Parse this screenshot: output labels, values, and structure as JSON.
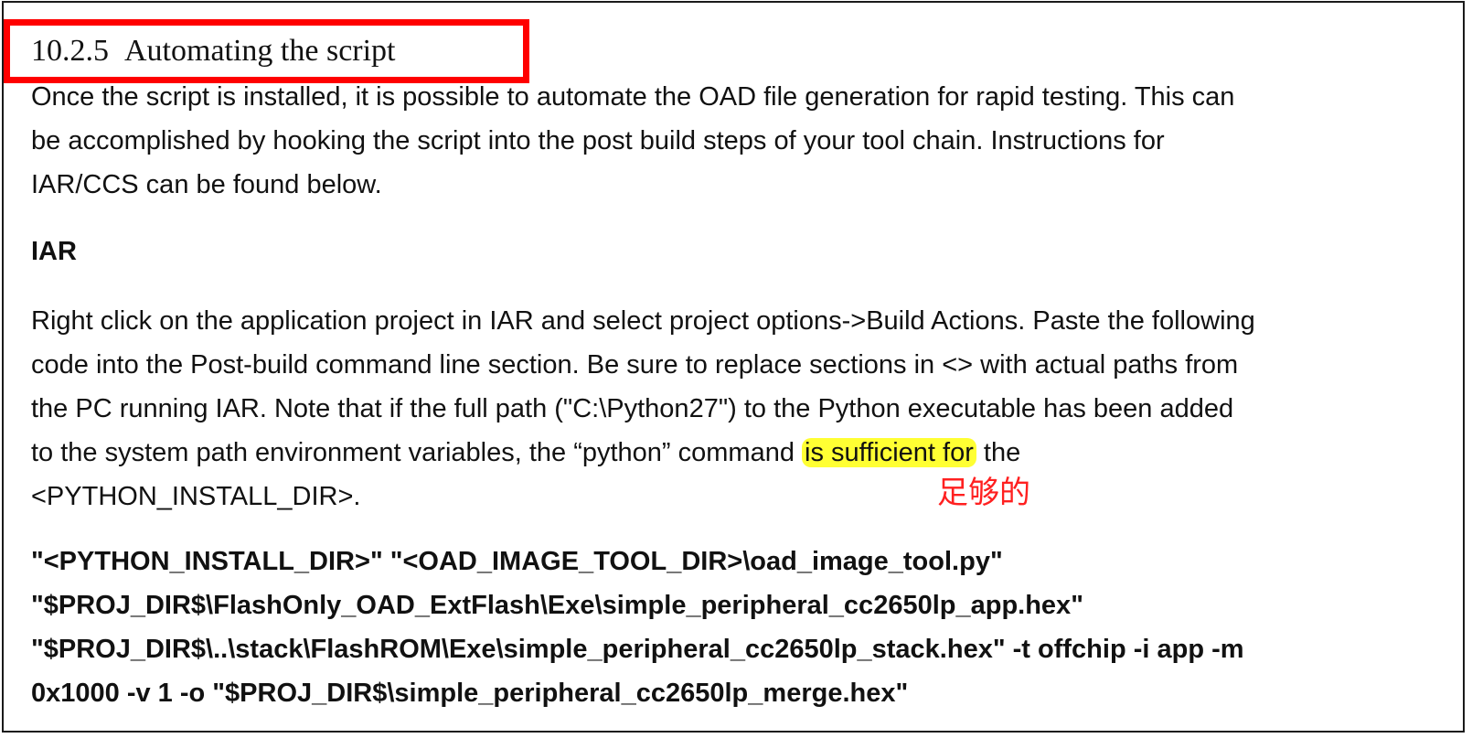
{
  "heading": {
    "number": "10.2.5",
    "title": "Automating the script"
  },
  "intro": {
    "lines": [
      "Once the script is installed, it is possible to automate the OAD file generation for rapid testing. This can",
      "be accomplished by hooking the script into the post build steps of your tool chain. Instructions for",
      "IAR/CCS can be found below."
    ]
  },
  "iar_heading": "IAR",
  "body": {
    "lines": [
      "Right click on the application project in IAR and select project options->Build Actions. Paste the following",
      "code into the Post-build command line section. Be sure to replace sections in <> with actual paths from",
      "the PC running IAR. Note that if the full path (\"C:\\Python27\") to the Python executable has been added"
    ],
    "line4_before": "to the system path environment variables, the “python” command ",
    "line4_highlight": "is sufficient for",
    "line4_after": " the",
    "line5": "<PYTHON_INSTALL_DIR>."
  },
  "annotation": {
    "text": "足够的",
    "color": "#ff2020"
  },
  "command": {
    "lines": [
      "\"<PYTHON_INSTALL_DIR>\" \"<OAD_IMAGE_TOOL_DIR>\\oad_image_tool.py\"",
      "\"$PROJ_DIR$\\FlashOnly_OAD_ExtFlash\\Exe\\simple_peripheral_cc2650lp_app.hex\"",
      "\"$PROJ_DIR$\\..\\stack\\FlashROM\\Exe\\simple_peripheral_cc2650lp_stack.hex\" -t offchip -i app -m",
      "0x1000 -v 1 -o \"$PROJ_DIR$\\simple_peripheral_cc2650lp_merge.hex\""
    ]
  },
  "colors": {
    "highlight": "#ffff33",
    "heading_box": "#ff0000",
    "text": "#111111"
  }
}
